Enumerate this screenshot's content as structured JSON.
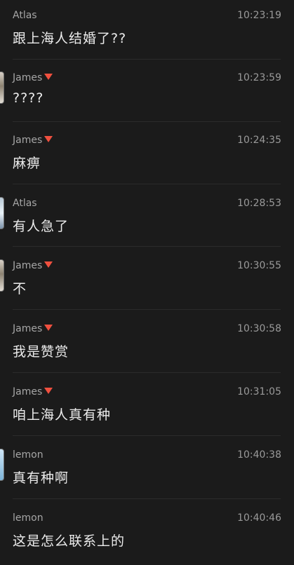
{
  "messages": [
    {
      "sender": "Atlas",
      "time": "10:23:19",
      "text": "跟上海人结婚了??",
      "badge": false
    },
    {
      "sender": "James",
      "time": "10:23:59",
      "text": "????",
      "badge": true
    },
    {
      "sender": "James",
      "time": "10:24:35",
      "text": "麻痹",
      "badge": true
    },
    {
      "sender": "Atlas",
      "time": "10:28:53",
      "text": "有人急了",
      "badge": false
    },
    {
      "sender": "James",
      "time": "10:30:55",
      "text": "不",
      "badge": true
    },
    {
      "sender": "James",
      "time": "10:30:58",
      "text": "我是赞赏",
      "badge": true
    },
    {
      "sender": "James",
      "time": "10:31:05",
      "text": "咱上海人真有种",
      "badge": true
    },
    {
      "sender": "lemon",
      "time": "10:40:38",
      "text": "真有种啊",
      "badge": false
    },
    {
      "sender": "lemon",
      "time": "10:40:46",
      "text": "这是怎么联系上的",
      "badge": false
    }
  ],
  "colors": {
    "background": "#1b1b1b",
    "sender_text": "#a6a6a6",
    "time_text": "#9a9a9a",
    "message_text": "#ececec",
    "badge": "#f0503f",
    "divider": "#2b2b2b"
  },
  "icons": {
    "badge": "red-down-triangle-icon",
    "avatar": "avatar"
  }
}
